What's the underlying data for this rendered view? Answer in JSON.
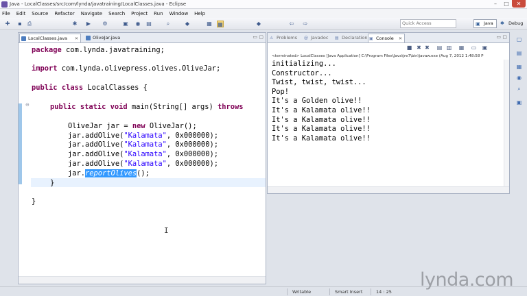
{
  "window": {
    "title": "Java - LocalClasses/src/com/lynda/javatraining/LocalClasses.java - Eclipse",
    "minimize": "–",
    "maximize": "□",
    "close": "✕"
  },
  "menu": [
    "File",
    "Edit",
    "Source",
    "Refactor",
    "Navigate",
    "Search",
    "Project",
    "Run",
    "Window",
    "Help"
  ],
  "toolbar": {
    "quick_access_placeholder": "Quick Access",
    "perspectives": [
      "Java",
      "Debug"
    ]
  },
  "editor": {
    "tabs": [
      {
        "label": "LocalClasses.java",
        "close": "✕"
      },
      {
        "label": "OliveJar.java"
      }
    ],
    "code": {
      "l1_kw": "package",
      "l1_rest": " com.lynda.javatraining;",
      "l2_kw": "import",
      "l2_rest": " com.lynda.olivepress.olives.OliveJar;",
      "l3_kw1": "public",
      "l3_kw2": "class",
      "l3_rest": " LocalClasses {",
      "l4_kw1": "public",
      "l4_kw2": "static",
      "l4_kw3": "void",
      "l4_rest": " main(String[] args) ",
      "l4_kw4": "throws",
      "l5_a": "OliveJar jar = ",
      "l5_kw": "new",
      "l5_b": " OliveJar();",
      "add_call": "jar.addOlive(",
      "add_arg": "\"Kalamata\"",
      "add_tail": ", 0x000000);",
      "l10_a": "jar.",
      "l10_sel": "reportOlives",
      "l10_b": "();",
      "close_inner": "}",
      "close_outer": "}"
    }
  },
  "console": {
    "tabs": [
      "Problems",
      "Javadoc",
      "Declaration",
      "Console"
    ],
    "tab_icons": [
      "⚠",
      "@",
      "▤",
      "▣"
    ],
    "close": "✕",
    "info": "<terminated> LocalClasses [Java Application] C:\\Program Files\\Java\\jre7\\bin\\javaw.exe (Aug 7, 2012 1:48:58 P",
    "output": [
      "initializing...",
      "Constructor...",
      "Twist, twist, twist...",
      "Pop!",
      "It's a Golden olive!!",
      "It's a Kalamata olive!!",
      "It's a Kalamata olive!!",
      "It's a Kalamata olive!!",
      "It's a Kalamata olive!!"
    ]
  },
  "status": {
    "writable": "Writable",
    "insert_mode": "Smart Insert",
    "position": "14 : 25"
  },
  "watermark": "lynda.com",
  "cursor_glyph": "I",
  "icons": {
    "new": "✚",
    "save": "▪",
    "print": "⎙",
    "debug": "✱",
    "run": "▶",
    "external": "⚙",
    "new_package": "▣",
    "new_class": "◉",
    "open_type": "▤",
    "search": "⌕",
    "mark": "◆",
    "toggle": "▦",
    "nav_prev": "⇦",
    "nav_next": "⇨",
    "minimize_view": "▭",
    "maximize_view": "▢"
  },
  "colors": {
    "keyword": "#7f0055",
    "string": "#2a00ff",
    "selection": "#3399ff",
    "current_line": "#e8f2fe"
  }
}
